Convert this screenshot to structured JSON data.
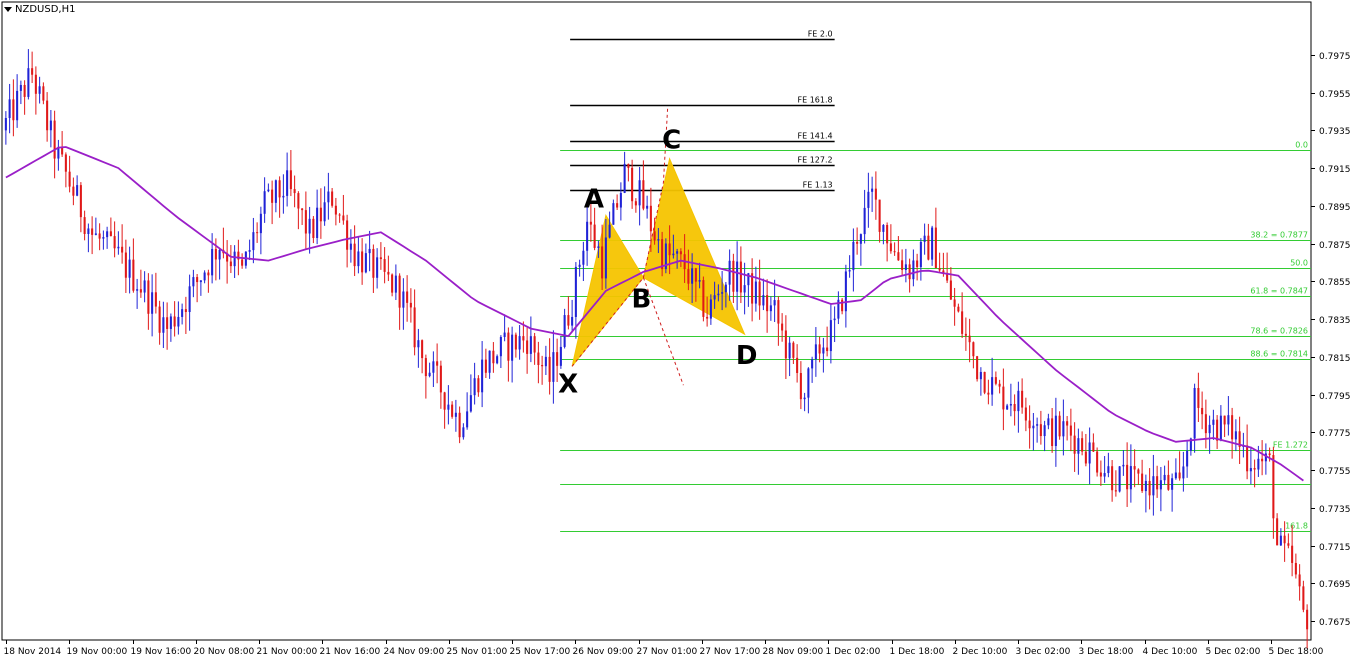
{
  "window": {
    "symbol_title": "NZDUSD,H1"
  },
  "colors": {
    "bull": "#1f22d6",
    "bear": "#e01818",
    "doji": "#2a9d2a",
    "ma": "#9a1fc8",
    "fib": "#33cc33",
    "fe": "#000000",
    "pattern_fill": "#f5c400",
    "axis": "#000000"
  },
  "chart_data": {
    "type": "candlestick",
    "title": "NZDUSD,H1",
    "ylim": [
      0.7665,
      0.8003
    ],
    "y_ticks": [
      "0.7975",
      "0.7955",
      "0.7935",
      "0.7915",
      "0.7895",
      "0.7875",
      "0.7855",
      "0.7835",
      "0.7815",
      "0.7795",
      "0.7775",
      "0.7755",
      "0.7735",
      "0.7715",
      "0.7695",
      "0.7675"
    ],
    "x_ticks": [
      "18 Nov 2014",
      "19 Nov 00:00",
      "19 Nov 16:00",
      "20 Nov 08:00",
      "21 Nov 00:00",
      "21 Nov 16:00",
      "24 Nov 09:00",
      "25 Nov 01:00",
      "25 Nov 17:00",
      "26 Nov 09:00",
      "27 Nov 01:00",
      "27 Nov 17:00",
      "28 Nov 09:00",
      "1 Dec 02:00",
      "1 Dec 18:00",
      "2 Dec 10:00",
      "3 Dec 02:00",
      "3 Dec 18:00",
      "4 Dec 10:00",
      "5 Dec 02:00",
      "5 Dec 18:00"
    ],
    "price_anchors": [
      {
        "i": 0,
        "p": 0.7935
      },
      {
        "i": 8,
        "p": 0.7965
      },
      {
        "i": 14,
        "p": 0.7925
      },
      {
        "i": 24,
        "p": 0.788
      },
      {
        "i": 30,
        "p": 0.787
      },
      {
        "i": 38,
        "p": 0.785
      },
      {
        "i": 44,
        "p": 0.783
      },
      {
        "i": 52,
        "p": 0.7855
      },
      {
        "i": 58,
        "p": 0.7875
      },
      {
        "i": 64,
        "p": 0.786
      },
      {
        "i": 70,
        "p": 0.7895
      },
      {
        "i": 76,
        "p": 0.7905
      },
      {
        "i": 82,
        "p": 0.788
      },
      {
        "i": 88,
        "p": 0.79
      },
      {
        "i": 94,
        "p": 0.787
      },
      {
        "i": 100,
        "p": 0.786
      },
      {
        "i": 106,
        "p": 0.785
      },
      {
        "i": 112,
        "p": 0.7815
      },
      {
        "i": 118,
        "p": 0.7795
      },
      {
        "i": 122,
        "p": 0.778
      },
      {
        "i": 128,
        "p": 0.781
      },
      {
        "i": 134,
        "p": 0.782
      },
      {
        "i": 140,
        "p": 0.7825
      },
      {
        "i": 146,
        "p": 0.7803
      },
      {
        "i": 152,
        "p": 0.7845
      },
      {
        "i": 156,
        "p": 0.7887
      },
      {
        "i": 160,
        "p": 0.7865
      },
      {
        "i": 166,
        "p": 0.7912
      },
      {
        "i": 170,
        "p": 0.79
      },
      {
        "i": 176,
        "p": 0.787
      },
      {
        "i": 182,
        "p": 0.7863
      },
      {
        "i": 188,
        "p": 0.7838
      },
      {
        "i": 194,
        "p": 0.786
      },
      {
        "i": 200,
        "p": 0.785
      },
      {
        "i": 206,
        "p": 0.7838
      },
      {
        "i": 210,
        "p": 0.7815
      },
      {
        "i": 214,
        "p": 0.7795
      },
      {
        "i": 218,
        "p": 0.782
      },
      {
        "i": 222,
        "p": 0.783
      },
      {
        "i": 228,
        "p": 0.788
      },
      {
        "i": 232,
        "p": 0.79
      },
      {
        "i": 238,
        "p": 0.787
      },
      {
        "i": 242,
        "p": 0.7862
      },
      {
        "i": 248,
        "p": 0.7876
      },
      {
        "i": 254,
        "p": 0.784
      },
      {
        "i": 260,
        "p": 0.781
      },
      {
        "i": 266,
        "p": 0.7795
      },
      {
        "i": 272,
        "p": 0.779
      },
      {
        "i": 278,
        "p": 0.7776
      },
      {
        "i": 284,
        "p": 0.7776
      },
      {
        "i": 290,
        "p": 0.7765
      },
      {
        "i": 296,
        "p": 0.7752
      },
      {
        "i": 302,
        "p": 0.7748
      },
      {
        "i": 308,
        "p": 0.7748
      },
      {
        "i": 314,
        "p": 0.7745
      },
      {
        "i": 318,
        "p": 0.779
      },
      {
        "i": 322,
        "p": 0.778
      },
      {
        "i": 328,
        "p": 0.7776
      },
      {
        "i": 332,
        "p": 0.7762
      },
      {
        "i": 338,
        "p": 0.7758
      },
      {
        "i": 340,
        "p": 0.7715
      },
      {
        "i": 344,
        "p": 0.7705
      },
      {
        "i": 347,
        "p": 0.7678
      }
    ],
    "bar_count": 348,
    "ma_points": [
      {
        "i": 0,
        "p": 0.791
      },
      {
        "i": 15,
        "p": 0.7927
      },
      {
        "i": 30,
        "p": 0.7915
      },
      {
        "i": 45,
        "p": 0.789
      },
      {
        "i": 60,
        "p": 0.7868
      },
      {
        "i": 70,
        "p": 0.7866
      },
      {
        "i": 80,
        "p": 0.7872
      },
      {
        "i": 90,
        "p": 0.7877
      },
      {
        "i": 100,
        "p": 0.7881
      },
      {
        "i": 112,
        "p": 0.7866
      },
      {
        "i": 125,
        "p": 0.7845
      },
      {
        "i": 140,
        "p": 0.783
      },
      {
        "i": 150,
        "p": 0.7826
      },
      {
        "i": 160,
        "p": 0.785
      },
      {
        "i": 170,
        "p": 0.786
      },
      {
        "i": 180,
        "p": 0.7866
      },
      {
        "i": 190,
        "p": 0.7862
      },
      {
        "i": 200,
        "p": 0.7857
      },
      {
        "i": 210,
        "p": 0.785
      },
      {
        "i": 220,
        "p": 0.7843
      },
      {
        "i": 228,
        "p": 0.7845
      },
      {
        "i": 235,
        "p": 0.7856
      },
      {
        "i": 245,
        "p": 0.7861
      },
      {
        "i": 254,
        "p": 0.7858
      },
      {
        "i": 265,
        "p": 0.7835
      },
      {
        "i": 280,
        "p": 0.7808
      },
      {
        "i": 295,
        "p": 0.7785
      },
      {
        "i": 305,
        "p": 0.7775
      },
      {
        "i": 312,
        "p": 0.777
      },
      {
        "i": 322,
        "p": 0.7772
      },
      {
        "i": 332,
        "p": 0.7767
      },
      {
        "i": 340,
        "p": 0.7758
      },
      {
        "i": 347,
        "p": 0.7748
      }
    ],
    "fib_levels": [
      {
        "label": "0.0",
        "p": 0.79245
      },
      {
        "label": "38.2 = 0.7877",
        "p": 0.7877
      },
      {
        "label": "50.0",
        "p": 0.7862
      },
      {
        "label": "61.8 = 0.7847",
        "p": 0.7847
      },
      {
        "label": "78.6 = 0.7826",
        "p": 0.7826
      },
      {
        "label": "88.6 = 0.7814",
        "p": 0.7814
      },
      {
        "label": "FE 1.272",
        "p": 0.77655
      },
      {
        "label": "",
        "p": 0.77475
      },
      {
        "label": "161.8",
        "p": 0.77225
      }
    ],
    "fe_levels": [
      {
        "label": "FE 2.0",
        "p": 0.79835
      },
      {
        "label": "FE 161.8",
        "p": 0.79485
      },
      {
        "label": "FE 141.4",
        "p": 0.79295
      },
      {
        "label": "FE 127.2",
        "p": 0.79165
      },
      {
        "label": "FE 1.13",
        "p": 0.79035
      }
    ],
    "pattern_points": [
      {
        "name": "X",
        "i": 151,
        "p": 0.781
      },
      {
        "name": "A",
        "i": 160,
        "p": 0.789
      },
      {
        "name": "B",
        "i": 170,
        "p": 0.7857
      },
      {
        "name": "C",
        "i": 177,
        "p": 0.792
      },
      {
        "name": "D",
        "i": 197,
        "p": 0.7827
      }
    ],
    "pattern_labels": [
      "X",
      "A",
      "B",
      "C",
      "D"
    ]
  }
}
